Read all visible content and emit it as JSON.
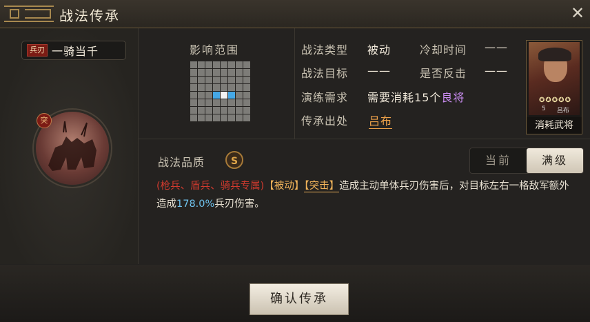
{
  "window": {
    "title": "战法传承"
  },
  "skill": {
    "type_tag": "兵刃",
    "name": "一骑当千",
    "emblem_badge": "突"
  },
  "range": {
    "label": "影响范围",
    "hit_cells": [
      [
        4,
        3
      ],
      [
        4,
        5
      ]
    ],
    "center_cell": [
      4,
      4
    ]
  },
  "info": {
    "type_label": "战法类型",
    "type_value": "被动",
    "cooldown_label": "冷却时间",
    "cooldown_value": "——",
    "target_label": "战法目标",
    "target_value": "——",
    "counter_label": "是否反击",
    "counter_value": "——",
    "require_label": "演练需求",
    "require_prefix": "需要消耗",
    "require_count": "15个",
    "require_suffix": "良将",
    "origin_label": "传承出处",
    "origin_value": "吕布"
  },
  "general_card": {
    "level": "5",
    "name": "吕布",
    "stars": 5,
    "caption": "消耗武将"
  },
  "quality": {
    "label": "战法品质",
    "grade": "S"
  },
  "toggle": {
    "current": "当前",
    "max": "满级",
    "selected": "满级"
  },
  "description": {
    "restriction": "(枪兵、盾兵、骑兵专属)",
    "tag1": "【被动】",
    "tag2": "【突击】",
    "text1": "造成主动单体兵刃伤害后，对目标左右一格敌军额外造成",
    "value": "178.0%",
    "text2": "兵刃伤害。"
  },
  "footer": {
    "confirm_label": "确认传承"
  },
  "colors": {
    "accent_gold": "#f0a34a",
    "purple": "#c98cf0",
    "red": "#d03a2e"
  }
}
